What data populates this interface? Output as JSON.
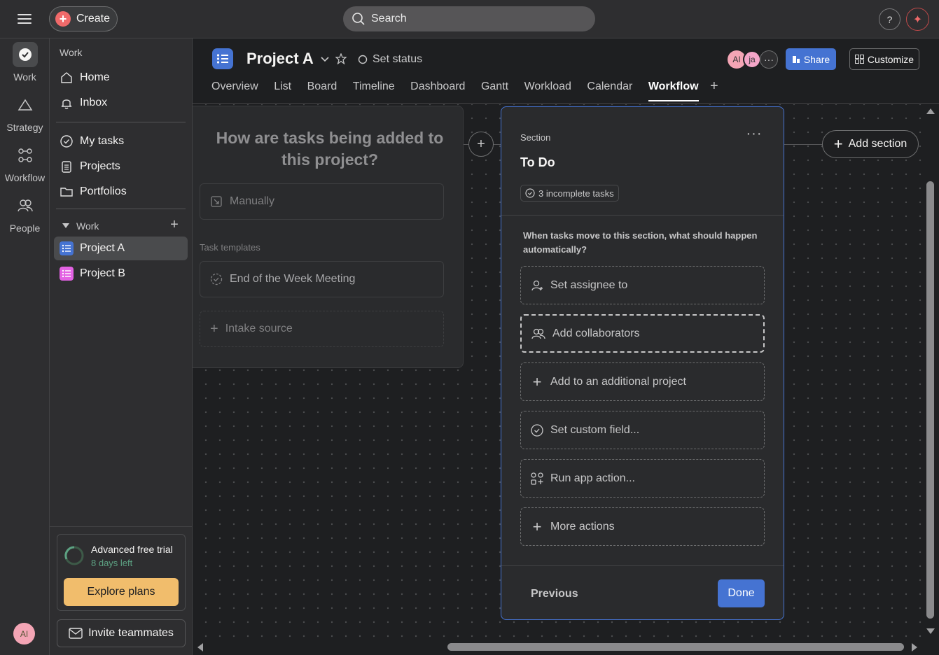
{
  "topbar": {
    "create_label": "Create",
    "search_placeholder": "Search",
    "help_label": "?"
  },
  "rail": {
    "items": [
      {
        "label": "Work",
        "icon": "check-circle-icon"
      },
      {
        "label": "Strategy",
        "icon": "triangle-icon"
      },
      {
        "label": "Workflow",
        "icon": "workflow-icon"
      },
      {
        "label": "People",
        "icon": "people-icon"
      }
    ],
    "avatar_initials": "AI"
  },
  "sidebar": {
    "work_heading": "Work",
    "nav": [
      {
        "label": "Home",
        "icon": "home-icon"
      },
      {
        "label": "Inbox",
        "icon": "bell-icon"
      }
    ],
    "nav2": [
      {
        "label": "My tasks",
        "icon": "check-circle-icon"
      },
      {
        "label": "Projects",
        "icon": "clipboard-icon"
      },
      {
        "label": "Portfolios",
        "icon": "folder-icon"
      }
    ],
    "team_heading": "Work",
    "projects": [
      {
        "label": "Project A",
        "color": "#4573d2"
      },
      {
        "label": "Project B",
        "color": "#e362e3"
      }
    ],
    "trial": {
      "title": "Advanced free trial",
      "days_left": "8 days left",
      "explore_label": "Explore plans"
    },
    "invite_label": "Invite teammates"
  },
  "project": {
    "title": "Project A",
    "set_status": "Set status",
    "tabs": [
      "Overview",
      "List",
      "Board",
      "Timeline",
      "Dashboard",
      "Gantt",
      "Workload",
      "Calendar",
      "Workflow"
    ],
    "active_tab": "Workflow",
    "members": [
      {
        "initials": "AI",
        "color": "#f4a5b5"
      },
      {
        "initials": "ja",
        "color": "#f4a5c8"
      }
    ],
    "share_label": "Share",
    "customize_label": "Customize"
  },
  "intake": {
    "question": "How are tasks being added to this project?",
    "manually_label": "Manually",
    "templates_heading": "Task templates",
    "template_item": "End of the Week Meeting",
    "intake_source_label": "Intake source"
  },
  "section": {
    "label": "Section",
    "title": "To Do",
    "badge": "3 incomplete tasks",
    "question": "When tasks move to this section, what should happen automatically?",
    "actions": [
      {
        "label": "Set assignee to",
        "icon": "person-icon"
      },
      {
        "label": "Add collaborators",
        "icon": "collaborators-icon"
      },
      {
        "label": "Add to an additional project",
        "icon": "plus-icon"
      },
      {
        "label": "Set custom field...",
        "icon": "check-circle-icon"
      },
      {
        "label": "Run app action...",
        "icon": "apps-icon"
      },
      {
        "label": "More actions",
        "icon": "plus-icon"
      }
    ],
    "previous_label": "Previous",
    "done_label": "Done"
  },
  "add_section_label": "Add section",
  "colors": {
    "accent": "#4573d2",
    "brand": "#f06a6a",
    "trial_button": "#f1bd6c",
    "background": "#1e1f21"
  }
}
